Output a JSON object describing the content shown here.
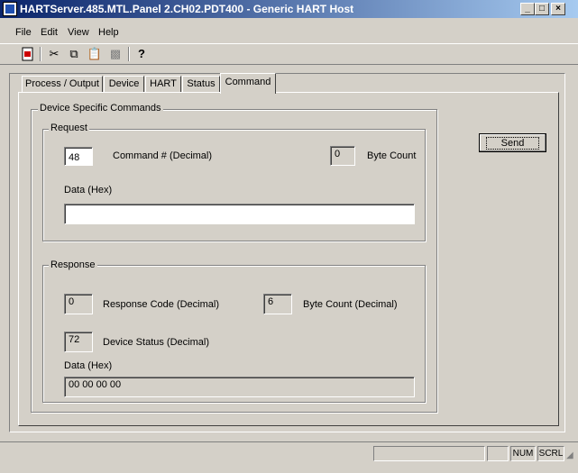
{
  "window": {
    "title": "HARTServer.485.MTL.Panel 2.CH02.PDT400 - Generic HART Host"
  },
  "menu": {
    "items": [
      "File",
      "Edit",
      "View",
      "Help"
    ]
  },
  "toolbar": {
    "icons": [
      "document-icon",
      "cut-icon",
      "copy-icon",
      "paste-icon",
      "disabled-grid-icon",
      "help-icon"
    ]
  },
  "tabs": [
    "Process / Output",
    "Device",
    "HART",
    "Status",
    "Command"
  ],
  "active_tab": "Command",
  "command": {
    "group_title": "Device Specific Commands",
    "request": {
      "title": "Request",
      "command_number": "48",
      "command_label": "Command # (Decimal)",
      "byte_count": "0",
      "byte_count_label": "Byte Count",
      "data_label": "Data (Hex)",
      "data_value": ""
    },
    "response": {
      "title": "Response",
      "response_code": "0",
      "response_code_label": "Response Code (Decimal)",
      "byte_count": "6",
      "byte_count_label": "Byte Count (Decimal)",
      "device_status": "72",
      "device_status_label": "Device Status (Decimal)",
      "data_label": "Data (Hex)",
      "data_value": "00 00 00 00"
    },
    "send_label": "Send"
  },
  "statusbar": {
    "num": "NUM",
    "scrl": "SCRL"
  }
}
